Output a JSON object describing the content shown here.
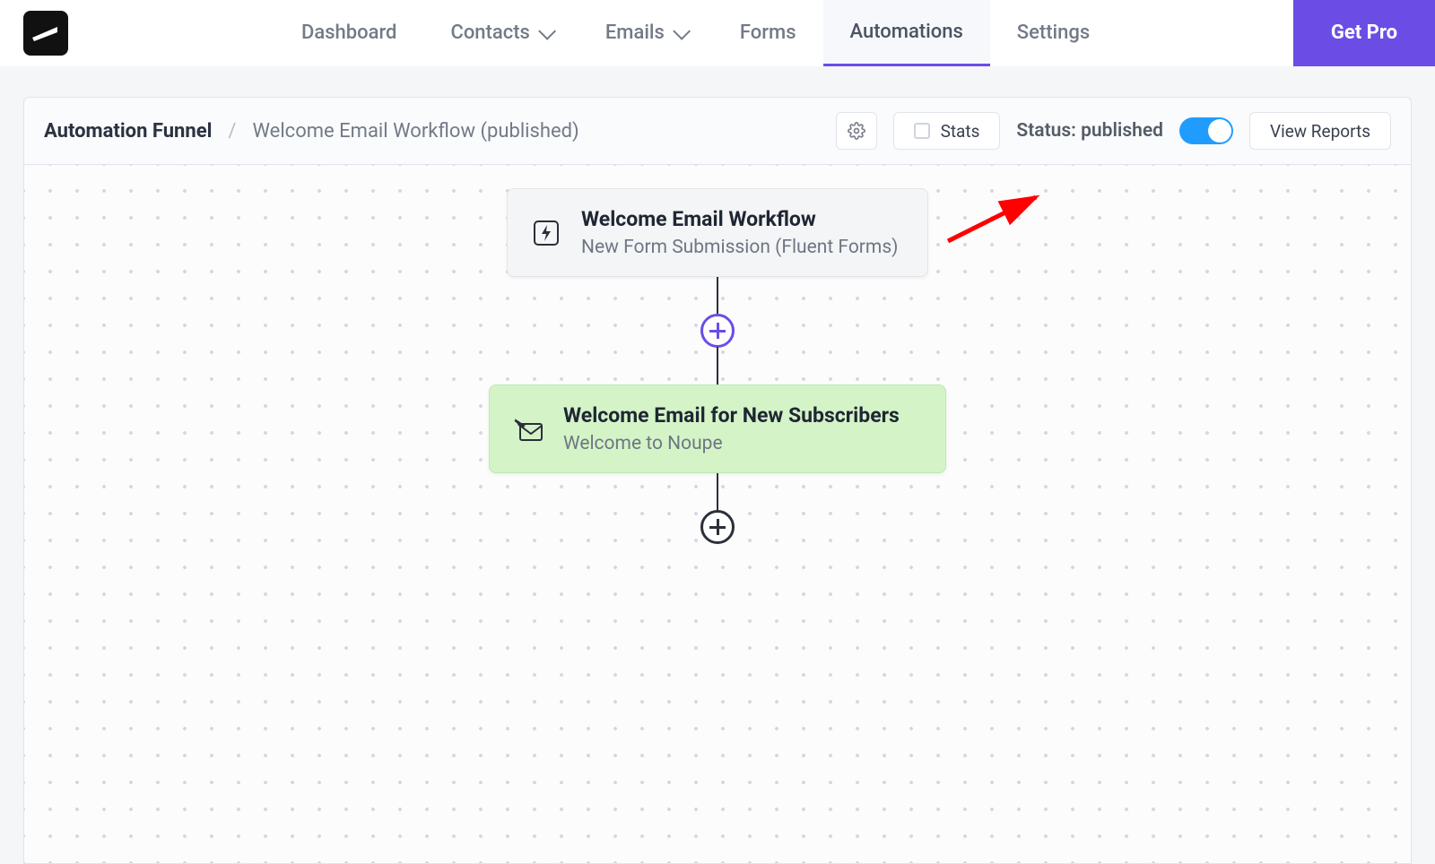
{
  "nav": {
    "items": [
      {
        "label": "Dashboard",
        "dropdown": false
      },
      {
        "label": "Contacts",
        "dropdown": true
      },
      {
        "label": "Emails",
        "dropdown": true
      },
      {
        "label": "Forms",
        "dropdown": false
      },
      {
        "label": "Automations",
        "dropdown": false,
        "active": true
      },
      {
        "label": "Settings",
        "dropdown": false
      }
    ],
    "cta": "Get Pro"
  },
  "subheader": {
    "breadcrumb_root": "Automation Funnel",
    "breadcrumb_sep": "/",
    "breadcrumb_title": "Welcome Email Workflow (published)",
    "stats_label": "Stats",
    "status_prefix": "Status: ",
    "status_value": "published",
    "view_reports": "View Reports",
    "toggle_on": true
  },
  "flow": {
    "trigger": {
      "title": "Welcome Email Workflow",
      "subtitle": "New Form Submission (Fluent Forms)"
    },
    "action": {
      "title": "Welcome Email for New Subscribers",
      "subtitle": "Welcome to Noupe"
    }
  }
}
